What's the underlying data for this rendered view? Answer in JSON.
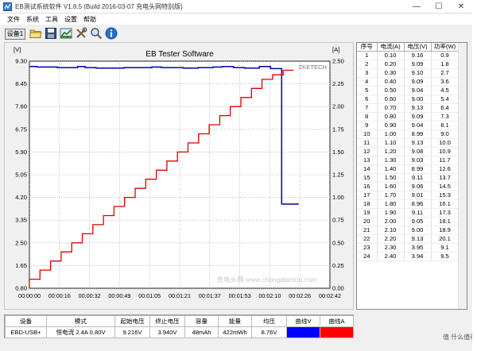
{
  "window": {
    "title": "EB测试系统软件 V1.8.5 (Build 2016-03-07 充电头网特别版)",
    "minimize": "—",
    "maximize": "☐",
    "close": "✕"
  },
  "menu": [
    "文件",
    "系统",
    "工具",
    "设置",
    "帮助"
  ],
  "toolbar": {
    "device_button": "设备1",
    "icons": [
      "folder-icon",
      "save-icon",
      "chart-icon",
      "tools-icon",
      "search-icon",
      "info-icon"
    ]
  },
  "chart_data": {
    "type": "line",
    "title": "EB Tester Software",
    "brand_label": "ZKETECH",
    "left_unit": "[V]",
    "right_unit": "[A]",
    "left_ticks": [
      "9.30",
      "8.45",
      "7.60",
      "6.75",
      "5.90",
      "5.05",
      "4.20",
      "3.35",
      "2.50",
      "1.65",
      "0.80"
    ],
    "right_ticks": [
      "2.50",
      "2.25",
      "2.00",
      "1.75",
      "1.50",
      "1.25",
      "1.00",
      "0.75",
      "0.50",
      "0.25",
      "0.00"
    ],
    "x_ticks": [
      "00:00:00",
      "00:00:16",
      "00:00:32",
      "00:00:49",
      "00:01:05",
      "00:01:21",
      "00:01:37",
      "00:01:53",
      "00:02:10",
      "00:02:26",
      "00:02:42"
    ],
    "ylim_left": [
      0.8,
      9.3
    ],
    "ylim_right": [
      0,
      2.5
    ],
    "xlim_seconds": [
      0,
      162
    ],
    "grid": true,
    "series": [
      {
        "name": "曲线V",
        "axis": "left",
        "color": "#0000aa",
        "points": [
          [
            0,
            9.1
          ],
          [
            4,
            9.1
          ],
          [
            4,
            9.08
          ],
          [
            15,
            9.08
          ],
          [
            15,
            9.06
          ],
          [
            26,
            9.06
          ],
          [
            26,
            9.1
          ],
          [
            30,
            9.1
          ],
          [
            30,
            9.06
          ],
          [
            36,
            9.06
          ],
          [
            36,
            9.04
          ],
          [
            51,
            9.04
          ],
          [
            51,
            9.06
          ],
          [
            66,
            9.06
          ],
          [
            66,
            9.08
          ],
          [
            71,
            9.08
          ],
          [
            71,
            9.06
          ],
          [
            83,
            9.06
          ],
          [
            83,
            9.04
          ],
          [
            91,
            9.04
          ],
          [
            91,
            9.06
          ],
          [
            99,
            9.06
          ],
          [
            99,
            9.08
          ],
          [
            104,
            9.08
          ],
          [
            104,
            9.1
          ],
          [
            110,
            9.1
          ],
          [
            110,
            9.06
          ],
          [
            116,
            9.06
          ],
          [
            116,
            9.04
          ],
          [
            124,
            9.04
          ],
          [
            124,
            9.1
          ],
          [
            130,
            9.1
          ],
          [
            130,
            9.02
          ],
          [
            136,
            9.02
          ],
          [
            136,
            3.95
          ],
          [
            145,
            3.95
          ],
          [
            145,
            3.94
          ]
        ]
      },
      {
        "name": "曲线A",
        "axis": "right",
        "color": "#dd0000",
        "step_seconds": 5.7,
        "values": [
          0.1,
          0.2,
          0.3,
          0.4,
          0.5,
          0.6,
          0.7,
          0.8,
          0.9,
          1.0,
          1.1,
          1.2,
          1.3,
          1.4,
          1.5,
          1.6,
          1.7,
          1.8,
          1.9,
          2.0,
          2.1,
          2.2,
          2.3,
          2.35,
          2.4
        ]
      }
    ]
  },
  "watermark_text": "充电头网 www.chongdiantou.com",
  "records": {
    "headers": [
      "序号",
      "电流(A)",
      "电压(V)",
      "功率(W)"
    ],
    "rows": [
      [
        "1",
        "0.10",
        "9.16",
        "0.9"
      ],
      [
        "2",
        "0.20",
        "9.09",
        "1.8"
      ],
      [
        "3",
        "0.30",
        "9.10",
        "2.7"
      ],
      [
        "4",
        "0.40",
        "9.09",
        "3.6"
      ],
      [
        "5",
        "0.50",
        "9.04",
        "4.5"
      ],
      [
        "6",
        "0.60",
        "9.00",
        "5.4"
      ],
      [
        "7",
        "0.70",
        "9.13",
        "6.4"
      ],
      [
        "8",
        "0.80",
        "9.09",
        "7.3"
      ],
      [
        "9",
        "0.90",
        "9.04",
        "8.1"
      ],
      [
        "10",
        "1.00",
        "8.99",
        "9.0"
      ],
      [
        "11",
        "1.10",
        "9.13",
        "10.0"
      ],
      [
        "12",
        "1.20",
        "9.08",
        "10.9"
      ],
      [
        "13",
        "1.30",
        "9.03",
        "11.7"
      ],
      [
        "14",
        "1.40",
        "8.99",
        "12.6"
      ],
      [
        "15",
        "1.50",
        "9.11",
        "13.7"
      ],
      [
        "16",
        "1.60",
        "9.06",
        "14.5"
      ],
      [
        "17",
        "1.70",
        "9.01",
        "15.3"
      ],
      [
        "18",
        "1.80",
        "8.96",
        "16.1"
      ],
      [
        "19",
        "1.90",
        "9.11",
        "17.3"
      ],
      [
        "20",
        "2.00",
        "9.05",
        "18.1"
      ],
      [
        "21",
        "2.10",
        "9.00",
        "18.9"
      ],
      [
        "22",
        "2.20",
        "9.13",
        "20.1"
      ],
      [
        "23",
        "2.30",
        "3.95",
        "9.1"
      ],
      [
        "24",
        "2.40",
        "3.94",
        "9.5"
      ]
    ]
  },
  "summary": {
    "headers": [
      "设备",
      "模式",
      "起始电压",
      "终止电压",
      "容量",
      "能量",
      "均压",
      "曲线V",
      "曲线A"
    ],
    "values": [
      "EBD-USB+",
      "恒电流  2.4A  0.80V",
      "9.216V",
      "3.940V",
      "48mAh",
      "422mWh",
      "8.76V",
      "",
      ""
    ],
    "curve_v_color": "#0000ff",
    "curve_a_color": "#ff0000"
  },
  "corner_watermark": "值 什么值得买"
}
